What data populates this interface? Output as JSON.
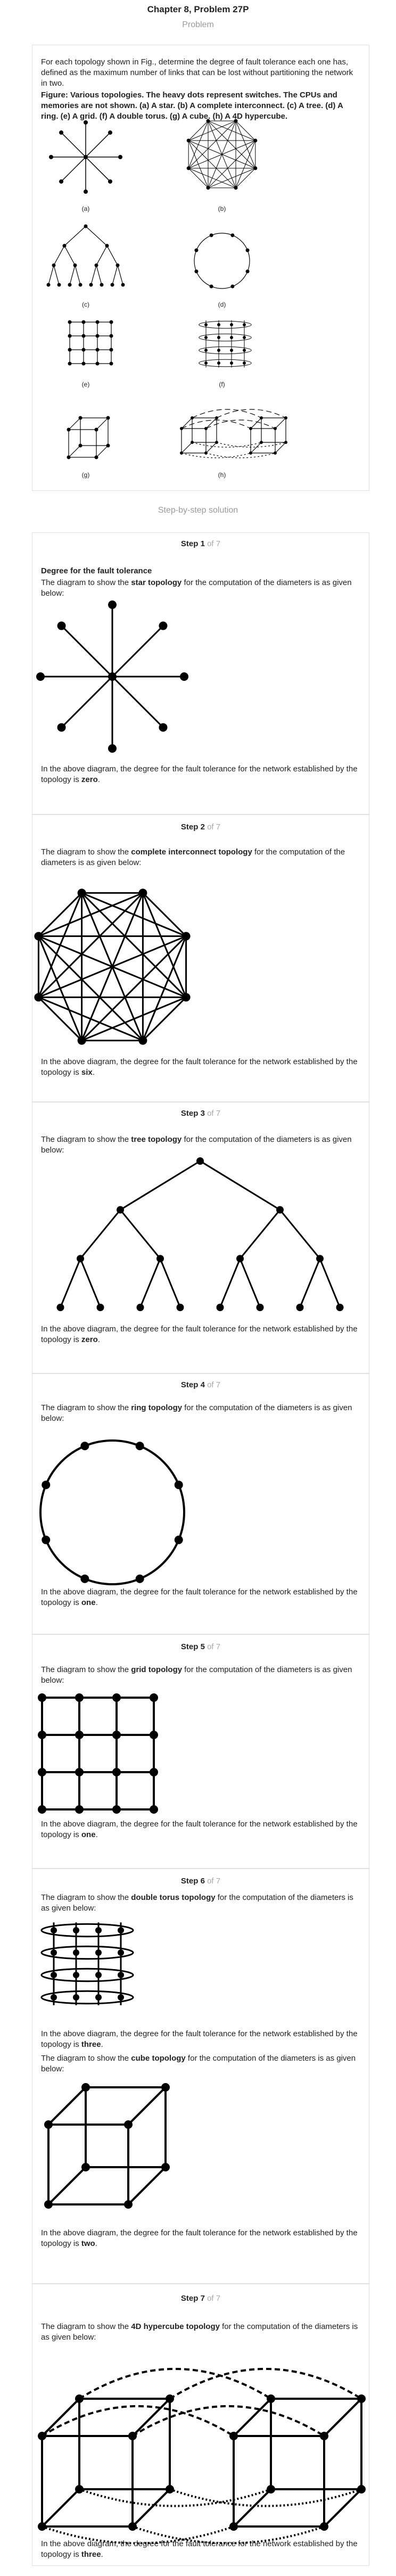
{
  "header": {
    "chapter_title": "Chapter 8, Problem 27P",
    "problem_label": "Problem"
  },
  "problem": {
    "text": "For each topology shown in Fig., determine the degree of fault tolerance each one has, defined as the maximum number of links that can be lost without partitioning the network in two.",
    "figure_caption": "Figure: Various topologies. The heavy dots represent switches. The CPUs and memories are not shown. (a) A star. (b) A complete interconnect. (c) A tree. (d) A ring. (e) A grid. (f) A double torus. (g) A cube. (h) A 4D hypercube.",
    "labels": [
      "(a)",
      "(b)",
      "(c)",
      "(d)",
      "(e)",
      "(f)",
      "(g)",
      "(h)"
    ]
  },
  "solution_label": "Step-by-step solution",
  "steps": [
    {
      "title": "Step 1",
      "of": "of 7",
      "heading": "Degree for the fault tolerance",
      "intro_a": "The diagram to show the ",
      "intro_b": "star topology",
      "intro_c": " for the computation of the diameters is as given below:",
      "concl": "In the above diagram, the degree for the fault tolerance for the network established by the topology is ",
      "value": "zero",
      "end": "."
    },
    {
      "title": "Step 2",
      "of": "of 7",
      "intro_a": "The diagram to show the ",
      "intro_b": "complete interconnect topology",
      "intro_c": " for the computation of the diameters is as given below:",
      "concl": "In the above diagram, the degree for the fault tolerance for the network established by the topology is ",
      "value": "six",
      "end": "."
    },
    {
      "title": "Step 3",
      "of": "of 7",
      "intro_a": "The diagram to show the ",
      "intro_b": "tree topology",
      "intro_c": " for the computation of the diameters is as given below:",
      "concl": "In the above diagram, the degree for the fault tolerance for the network established by the topology is ",
      "value": "zero",
      "end": "."
    },
    {
      "title": "Step 4",
      "of": "of 7",
      "intro_a": "The diagram to show the ",
      "intro_b": "ring topology",
      "intro_c": " for the computation of the diameters is as given below:",
      "concl": "In the above diagram, the degree for the fault tolerance for the network established by the topology is ",
      "value": "one",
      "end": "."
    },
    {
      "title": "Step 5",
      "of": "of 7",
      "intro_a": "The diagram to show the ",
      "intro_b": "grid topology",
      "intro_c": " for the computation of the diameters is as given below:",
      "concl": "In the above diagram, the degree for the fault tolerance for the network established by the topology is ",
      "value": "one",
      "end": "."
    },
    {
      "title": "Step 6",
      "of": "of 7",
      "intro_a": "The diagram to show the ",
      "intro_b": "double torus topology",
      "intro_c": " for the computation of the diameters is as given below:",
      "concl": "In the above diagram, the degree for the fault tolerance for the network established by the topology is ",
      "value": "three",
      "end": ".",
      "intro2_a": "The diagram to show the ",
      "intro2_b": "cube topology",
      "intro2_c": " for the computation of the diameters is as given below:",
      "concl2": "In the above diagram, the degree for the fault tolerance for the network established by the topology is ",
      "value2": "two",
      "end2": "."
    },
    {
      "title": "Step 7",
      "of": "of 7",
      "intro_a": "The diagram to show the ",
      "intro_b": "4D hypercube topology",
      "intro_c": " for the computation of the diameters is as given below:",
      "concl": "In the above diagram, the degree for the fault tolerance for the network established by the topology is ",
      "value": "three",
      "end": "."
    }
  ]
}
